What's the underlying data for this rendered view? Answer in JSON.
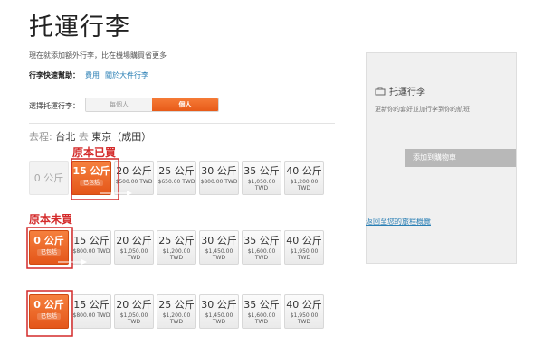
{
  "page": {
    "title": "托運行李"
  },
  "intro": "現在就添加額外行李，比在機場購買省更多",
  "quick_help": {
    "label": "行李快速幫助：",
    "links": [
      "費用",
      "關於大件行李"
    ]
  },
  "selector": {
    "label": "選擇托運行李：",
    "options": [
      "每個人",
      "個人"
    ],
    "selected": "個人"
  },
  "route": {
    "from_prefix": "去程:",
    "from": "台北",
    "to_prefix": "去",
    "to": "東京（成田）"
  },
  "annotations": {
    "already_bought": "原本已買",
    "not_bought": "原本未買"
  },
  "rows": [
    {
      "tiles": [
        {
          "weight": "0 公斤",
          "price": "",
          "state": "dim"
        },
        {
          "weight": "15 公斤",
          "price": "已包括",
          "state": "selected"
        },
        {
          "weight": "20 公斤",
          "price": "$500.00 TWD",
          "state": "normal"
        },
        {
          "weight": "25 公斤",
          "price": "$650.00 TWD",
          "state": "normal"
        },
        {
          "weight": "30 公斤",
          "price": "$800.00 TWD",
          "state": "normal"
        },
        {
          "weight": "35 公斤",
          "price": "$1,050.00\nTWD",
          "state": "normal"
        },
        {
          "weight": "40 公斤",
          "price": "$1,200.00\nTWD",
          "state": "normal"
        }
      ]
    },
    {
      "tiles": [
        {
          "weight": "0 公斤",
          "price": "已包括",
          "state": "selected"
        },
        {
          "weight": "15 公斤",
          "price": "$800.00 TWD",
          "state": "normal"
        },
        {
          "weight": "20 公斤",
          "price": "$1,050.00\nTWD",
          "state": "normal"
        },
        {
          "weight": "25 公斤",
          "price": "$1,200.00\nTWD",
          "state": "normal"
        },
        {
          "weight": "30 公斤",
          "price": "$1,450.00\nTWD",
          "state": "normal"
        },
        {
          "weight": "35 公斤",
          "price": "$1,600.00\nTWD",
          "state": "normal"
        },
        {
          "weight": "40 公斤",
          "price": "$1,950.00\nTWD",
          "state": "normal"
        }
      ]
    },
    {
      "tiles": [
        {
          "weight": "0 公斤",
          "price": "已包括",
          "state": "selected"
        },
        {
          "weight": "15 公斤",
          "price": "$800.00 TWD",
          "state": "normal"
        },
        {
          "weight": "20 公斤",
          "price": "$1,050.00\nTWD",
          "state": "normal"
        },
        {
          "weight": "25 公斤",
          "price": "$1,200.00\nTWD",
          "state": "normal"
        },
        {
          "weight": "30 公斤",
          "price": "$1,450.00\nTWD",
          "state": "normal"
        },
        {
          "weight": "35 公斤",
          "price": "$1,600.00\nTWD",
          "state": "normal"
        },
        {
          "weight": "40 公斤",
          "price": "$1,950.00\nTWD",
          "state": "normal"
        }
      ]
    }
  ],
  "sidebar": {
    "title": "托運行李",
    "description": "更新你的套好並加行李到你的航班",
    "button": "添加到購物車"
  },
  "back_link": "返回至您的旅程概覽",
  "colors": {
    "accent": "#e85a18",
    "annotation": "#d42a2a",
    "link": "#2a7fb5"
  }
}
